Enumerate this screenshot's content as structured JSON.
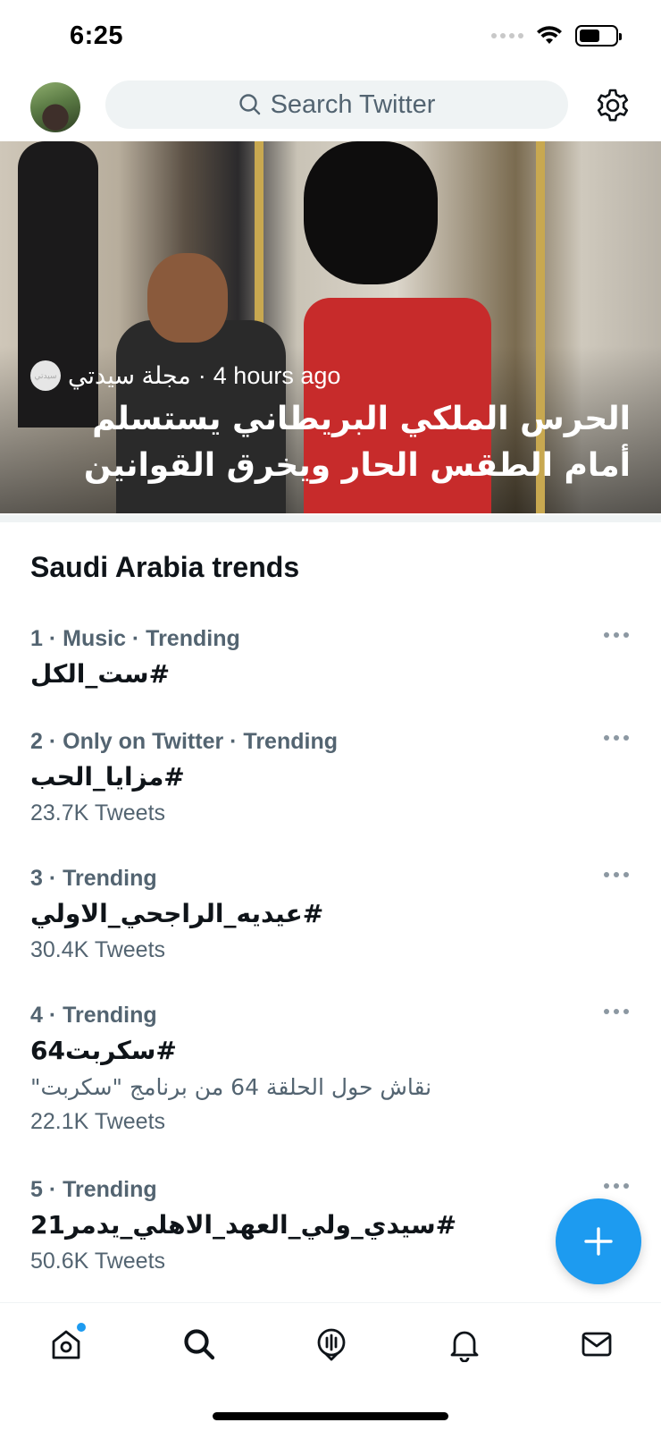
{
  "status_bar": {
    "time": "6:25"
  },
  "header": {
    "search_placeholder": "Search Twitter"
  },
  "hero": {
    "source_name": "مجلة سيدتي",
    "source_logo_text": "سيدتي",
    "separator": "·",
    "time_ago": "4 hours ago",
    "headline": "الحرس الملكي البريطاني يستسلم أمام الطقس الحار ويخرق القوانين"
  },
  "trends_section": {
    "title": "Saudi Arabia trends",
    "items": [
      {
        "meta": "1 · Music · Trending",
        "name": "#ست_الكل",
        "description": "",
        "count": ""
      },
      {
        "meta": "2 · Only on Twitter · Trending",
        "name": "#مزايا_الحب",
        "description": "",
        "count": "23.7K Tweets"
      },
      {
        "meta": "3 · Trending",
        "name": "#عيديه_الراجحي_الاولي",
        "description": "",
        "count": "30.4K Tweets"
      },
      {
        "meta": "4 · Trending",
        "name": "#سكربت64",
        "description": "نقاش حول الحلقة 64 من برنامج \"سكربت\"",
        "count": "22.1K Tweets"
      },
      {
        "meta": "5 · Trending",
        "name": "#سيدي_ولي_العهد_الاهلي_يدمر21",
        "description": "",
        "count": "50.6K Tweets"
      }
    ]
  },
  "colors": {
    "accent": "#1d9bf0",
    "text_primary": "#0f1419",
    "text_secondary": "#536471",
    "search_bg": "#eff3f4"
  },
  "bottom_nav": {
    "items": [
      "home-icon",
      "search-icon",
      "spaces-icon",
      "notifications-icon",
      "messages-icon"
    ]
  }
}
